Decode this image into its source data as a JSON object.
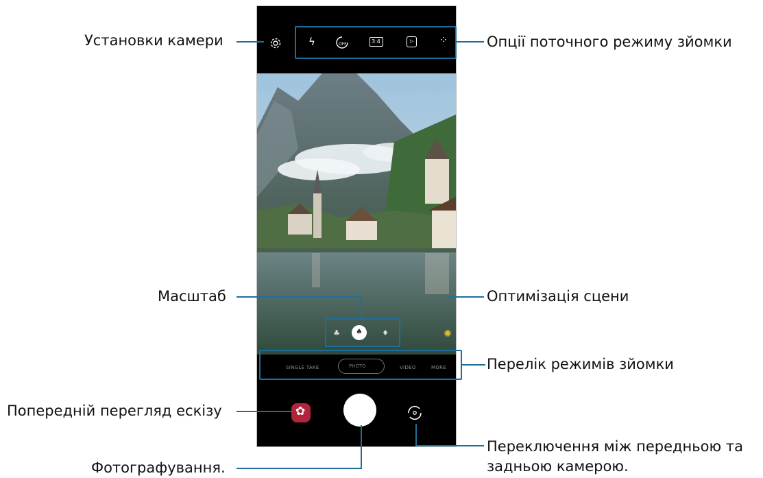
{
  "labels": {
    "camera_settings": "Установки камери",
    "mode_options": "Опції поточного режиму зйомки",
    "zoom": "Масштаб",
    "scene_optimizer": "Оптимізація сцени",
    "modes_list": "Перелік режимів зйомки",
    "thumbnail_preview": "Попередній перегляд ескізу",
    "take_photo": "Фотографування.",
    "switch_camera_line1": "Переключення між передньою та",
    "switch_camera_line2": "задньою камерою."
  },
  "top_bar": {
    "ratio": "3:4",
    "timer": "OFF"
  },
  "modes": [
    "SINGLE TAKE",
    "PHOTO",
    "VIDEO",
    "MORE"
  ],
  "colors": {
    "callout": "#1f6e9a",
    "thumbnail": "#b0243c"
  }
}
